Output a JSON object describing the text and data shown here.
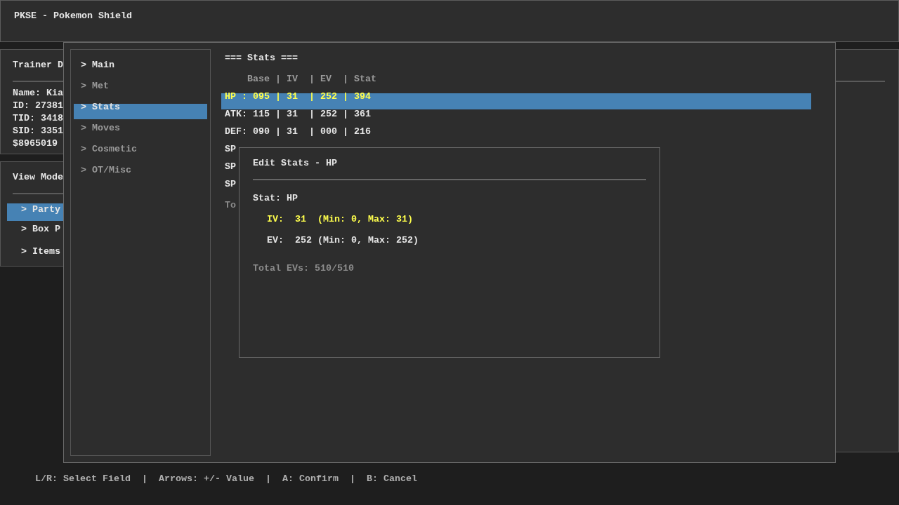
{
  "app": {
    "title": "PKSE - Pokemon Shield"
  },
  "trainer_panel": {
    "title": "Trainer D",
    "lines": [
      "Name: Kia",
      "ID: 27381",
      "TID: 3418",
      "SID: 3351",
      "$8965019"
    ]
  },
  "view_mode_panel": {
    "title": "View Mode",
    "items": [
      {
        "label": "> Party",
        "selected": true
      },
      {
        "label": "> Box P",
        "selected": false
      },
      {
        "label": "> Items",
        "selected": false
      }
    ]
  },
  "editor": {
    "menu": [
      {
        "label": "> Main",
        "selected": false,
        "dimmed": false
      },
      {
        "label": "> Met",
        "selected": false,
        "dimmed": true
      },
      {
        "label": "> Stats",
        "selected": true,
        "dimmed": false
      },
      {
        "label": "> Moves",
        "selected": false,
        "dimmed": true
      },
      {
        "label": "> Cosmetic",
        "selected": false,
        "dimmed": true
      },
      {
        "label": "> OT/Misc",
        "selected": false,
        "dimmed": true
      }
    ],
    "stats": {
      "title": "=== Stats ===",
      "header": "Base | IV  | EV  | Stat",
      "rows": [
        {
          "text": "HP : 095 | 31  | 252 | 394",
          "selected": true
        },
        {
          "text": "ATK: 115 | 31  | 252 | 361",
          "selected": false
        },
        {
          "text": "DEF: 090 | 31  | 000 | 216",
          "selected": false
        },
        {
          "text": "SP",
          "selected": false
        },
        {
          "text": "SP",
          "selected": false
        },
        {
          "text": "SP",
          "selected": false
        }
      ],
      "total": "To"
    }
  },
  "dialog": {
    "title": "Edit Stats - HP",
    "stat": "Stat: HP",
    "fields": [
      {
        "text": "IV:  31  (Min: 0, Max: 31)",
        "selected": true
      },
      {
        "text": "EV:  252 (Min: 0, Max: 252)",
        "selected": false
      }
    ],
    "total": "Total EVs: 510/510"
  },
  "status_bar": {
    "hints": "L/R: Select Field  |  Arrows: +/- Value  |  A: Confirm  |  B: Cancel"
  }
}
